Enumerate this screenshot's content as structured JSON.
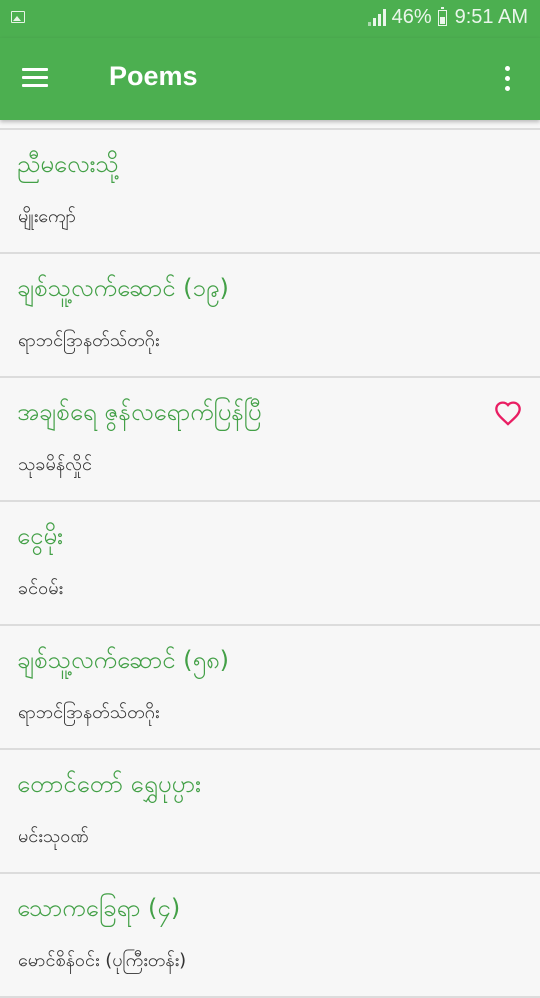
{
  "status_bar": {
    "battery": "46%",
    "time": "9:51 AM"
  },
  "app_bar": {
    "title": "Poems"
  },
  "poems": [
    {
      "title": "ညီမလေးသို့",
      "author": "မျိုးကျော်",
      "favorite": false
    },
    {
      "title": "ချစ်သူ့လက်ဆောင် (၁၉)",
      "author": "ရာဘင်ဒြာနတ်သ်တဂိုး",
      "favorite": false
    },
    {
      "title": "အချစ်ရေ ဇွန်လရောက်ပြန်ပြီ",
      "author": "သုခမိန်လှိုင်",
      "favorite": true
    },
    {
      "title": "ငွေမိုး",
      "author": "ခင်ဝမ်း",
      "favorite": false
    },
    {
      "title": "ချစ်သူ့လက်ဆောင် (၅၈)",
      "author": "ရာဘင်ဒြာနတ်သ်တဂိုး",
      "favorite": false
    },
    {
      "title": "တောင်တော် ရွှေပုပ္ပား",
      "author": "မင်းသုဝဏ်",
      "favorite": false
    },
    {
      "title": "သောကခြေရာ (၄)",
      "author": "မောင်စိန်ဝင်း (ပုကြီးတန်း)",
      "favorite": false
    }
  ],
  "colors": {
    "primary": "#4caf50",
    "title_text": "#43a047",
    "favorite": "#e91e63"
  }
}
